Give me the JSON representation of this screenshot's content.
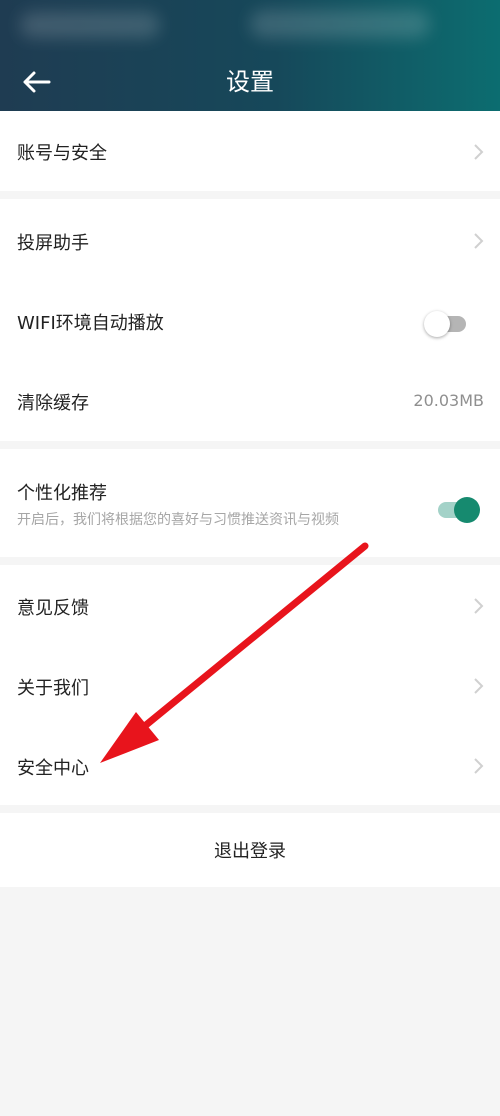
{
  "header": {
    "title": "设置"
  },
  "sections": {
    "account": {
      "label": "账号与安全"
    },
    "cast": {
      "label": "投屏助手"
    },
    "wifi_autoplay": {
      "label": "WIFI环境自动播放",
      "enabled": false
    },
    "clear_cache": {
      "label": "清除缓存",
      "value": "20.03MB"
    },
    "personalize": {
      "label": "个性化推荐",
      "description": "开启后，我们将根据您的喜好与习惯推送资讯与视频",
      "enabled": true
    },
    "feedback": {
      "label": "意见反馈"
    },
    "about": {
      "label": "关于我们"
    },
    "security_center": {
      "label": "安全中心"
    }
  },
  "logout": {
    "label": "退出登录"
  },
  "colors": {
    "header_start": "#1f3c52",
    "header_end": "#0c6d70",
    "toggle_on": "#168a6f",
    "annotation_arrow": "#e8141c"
  }
}
